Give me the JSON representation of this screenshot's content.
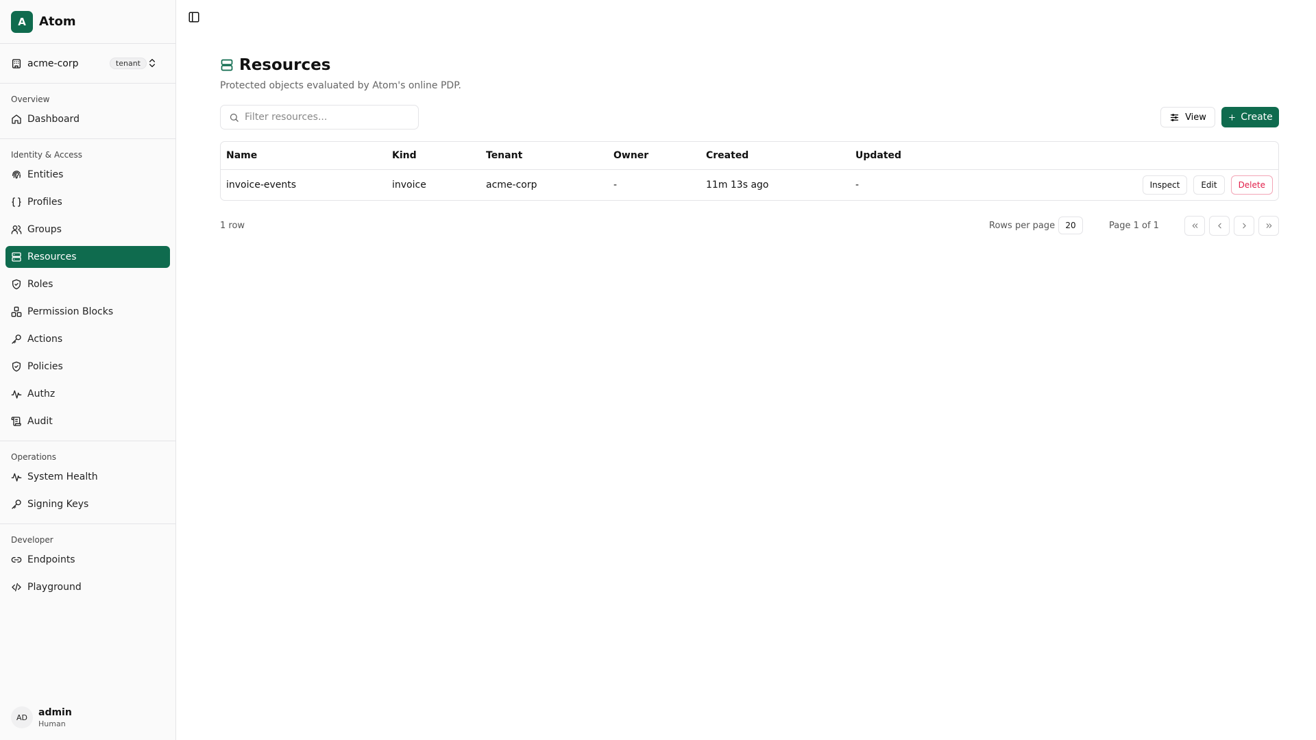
{
  "app": {
    "logo_letter": "A",
    "name": "Atom",
    "accent": "#0f6b4e"
  },
  "tenant": {
    "name": "acme-corp",
    "badge": "tenant"
  },
  "sidebar": {
    "sections": [
      {
        "title": "Overview",
        "items": [
          {
            "label": "Dashboard",
            "icon": "home-icon"
          }
        ]
      },
      {
        "title": "Identity & Access",
        "items": [
          {
            "label": "Entities",
            "icon": "fingerprint-icon"
          },
          {
            "label": "Profiles",
            "icon": "braces-icon"
          },
          {
            "label": "Groups",
            "icon": "users-icon"
          },
          {
            "label": "Resources",
            "icon": "server-icon",
            "active": true
          },
          {
            "label": "Roles",
            "icon": "shield-check-icon"
          },
          {
            "label": "Permission Blocks",
            "icon": "blocks-icon"
          },
          {
            "label": "Actions",
            "icon": "key-icon"
          },
          {
            "label": "Policies",
            "icon": "shield-check-icon"
          },
          {
            "label": "Authz",
            "icon": "activity-icon"
          },
          {
            "label": "Audit",
            "icon": "scroll-icon"
          }
        ]
      },
      {
        "title": "Operations",
        "items": [
          {
            "label": "System Health",
            "icon": "activity-icon"
          },
          {
            "label": "Signing Keys",
            "icon": "key-icon"
          }
        ]
      },
      {
        "title": "Developer",
        "items": [
          {
            "label": "Endpoints",
            "icon": "link-icon"
          },
          {
            "label": "Playground",
            "icon": "code-icon"
          }
        ]
      }
    ]
  },
  "user": {
    "initials": "AD",
    "name": "admin",
    "role": "Human"
  },
  "page": {
    "title": "Resources",
    "subtitle": "Protected objects evaluated by Atom's online PDP.",
    "filter_placeholder": "Filter resources...",
    "view_label": "View",
    "create_label": "Create"
  },
  "table": {
    "columns": [
      "Name",
      "Kind",
      "Tenant",
      "Owner",
      "Created",
      "Updated"
    ],
    "rows": [
      {
        "name": "invoice-events",
        "kind": "invoice",
        "tenant": "acme-corp",
        "owner": "-",
        "created": "11m 13s ago",
        "updated": "-"
      }
    ],
    "row_actions": {
      "inspect": "Inspect",
      "edit": "Edit",
      "delete": "Delete"
    }
  },
  "footer": {
    "row_count": "1 row",
    "rows_per_page_label": "Rows per page",
    "rows_per_page": "20",
    "page_info": "Page 1 of 1"
  }
}
